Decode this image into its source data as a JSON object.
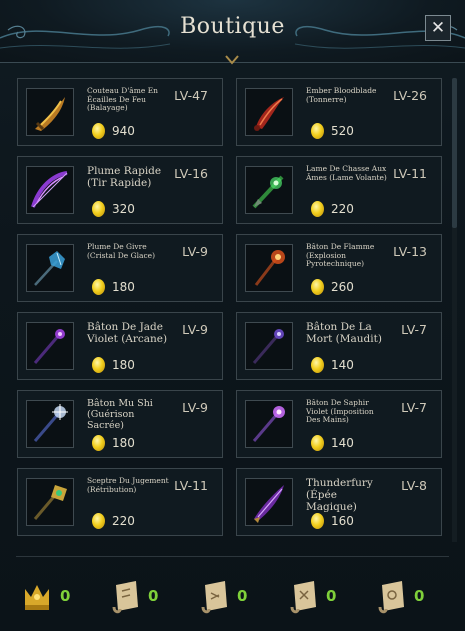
{
  "window": {
    "title": "Boutique",
    "close_label": "✕"
  },
  "colors": {
    "coin": "#f2cf1e",
    "count_green": "#7fd03a",
    "border": "#3a454b"
  },
  "items": [
    {
      "name": "Couteau D'âme En Écailles De Feu (Balayage)",
      "level": "LV-47",
      "price": "940",
      "icon": "flame-scale-knife-icon"
    },
    {
      "name": "Ember Bloodblade (Tonnerre)",
      "level": "LV-26",
      "price": "520",
      "icon": "ember-bloodblade-icon"
    },
    {
      "name": "Plume Rapide (Tir Rapide)",
      "level": "LV-16",
      "price": "320",
      "icon": "purple-bow-icon"
    },
    {
      "name": "Lame De Chasse Aux Âmes (Lame Volante)",
      "level": "LV-11",
      "price": "220",
      "icon": "green-soul-blade-icon"
    },
    {
      "name": "Plume De Givre (Cristal De Glace)",
      "level": "LV-9",
      "price": "180",
      "icon": "frost-crystal-staff-icon"
    },
    {
      "name": "Bâton De Flamme (Explosion Pyrotechnique)",
      "level": "LV-13",
      "price": "260",
      "icon": "flame-staff-icon"
    },
    {
      "name": "Bâton De Jade Violet (Arcane)",
      "level": "LV-9",
      "price": "180",
      "icon": "violet-jade-staff-icon"
    },
    {
      "name": "Bâton De La Mort (Maudit)",
      "level": "LV-7",
      "price": "140",
      "icon": "death-staff-icon"
    },
    {
      "name": "Bâton Mu Shi (Guérison Sacrée)",
      "level": "LV-9",
      "price": "180",
      "icon": "mu-shi-staff-icon"
    },
    {
      "name": "Bâton De Saphir Violet (Imposition Des Mains)",
      "level": "LV-7",
      "price": "140",
      "icon": "sapphire-staff-icon"
    },
    {
      "name": "Sceptre Du Jugement (Rétribution)",
      "level": "LV-11",
      "price": "220",
      "icon": "judgement-scepter-icon"
    },
    {
      "name": "Thunderfury (Épée Magique)",
      "level": "LV-8",
      "price": "160",
      "icon": "thunderfury-sword-icon"
    }
  ],
  "footer": [
    {
      "icon": "gold-crown-icon",
      "count": "0"
    },
    {
      "icon": "scroll-1-icon",
      "count": "0"
    },
    {
      "icon": "scroll-2-icon",
      "count": "0"
    },
    {
      "icon": "scroll-3-icon",
      "count": "0"
    },
    {
      "icon": "scroll-4-icon",
      "count": "0"
    }
  ]
}
